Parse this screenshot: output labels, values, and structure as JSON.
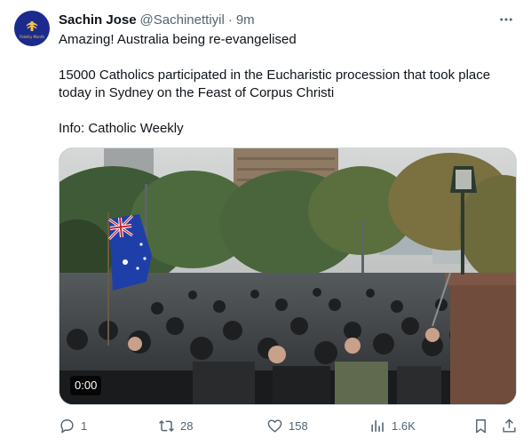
{
  "tweet": {
    "author_name": "Sachin Jose",
    "author_handle": "@Sachinettiyil",
    "separator": "·",
    "time": "9m",
    "avatar_text": "Fidelity Month",
    "text_lines": [
      "Amazing! Australia being re-evangelised",
      "15000 Catholics participated in the Eucharistic procession that took place today in Sydney on the Feast of Corpus Christi",
      "Info: Catholic Weekly"
    ],
    "video_timestamp": "0:00"
  },
  "actions": {
    "reply_count": "1",
    "retweet_count": "28",
    "like_count": "158",
    "views_count": "1.6K"
  },
  "icons": {
    "more": "more-horizontal-icon",
    "reply": "reply-icon",
    "retweet": "retweet-icon",
    "like": "heart-icon",
    "views": "analytics-icon",
    "bookmark": "bookmark-icon",
    "share": "share-icon"
  },
  "colors": {
    "text": "#0f1419",
    "secondary": "#536471",
    "border": "#cfd9de",
    "avatar_bg": "#1b2a8c"
  }
}
